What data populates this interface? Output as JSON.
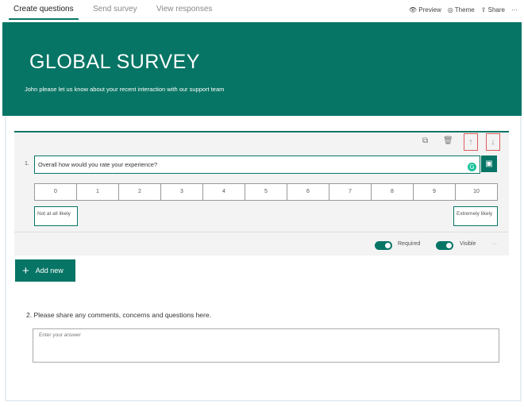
{
  "tabs": [
    {
      "label": "Create questions"
    },
    {
      "label": "Send survey"
    },
    {
      "label": "View responses"
    }
  ],
  "actions": {
    "preview": "Preview",
    "theme": "Theme",
    "share": "Share",
    "more": "···"
  },
  "banner": {
    "title": "GLOBAL SURVEY",
    "subtitle": "John please let us know about your recent interaction with our support team"
  },
  "question1": {
    "number": "1.",
    "text": "Overall how would you rate your experience?",
    "scale": [
      "0",
      "1",
      "2",
      "3",
      "4",
      "5",
      "6",
      "7",
      "8",
      "9",
      "10"
    ],
    "low_label": "Not at all likely",
    "high_label": "Extremely likely",
    "required_label": "Required",
    "visible_label": "Visible",
    "required": true,
    "visible": true
  },
  "add_new": "Add new",
  "question2": {
    "text": "2. Please share any comments, concerns and questions here.",
    "placeholder": "Enter your answer"
  },
  "colors": {
    "accent": "#077565",
    "highlight": "#e05a5a"
  }
}
